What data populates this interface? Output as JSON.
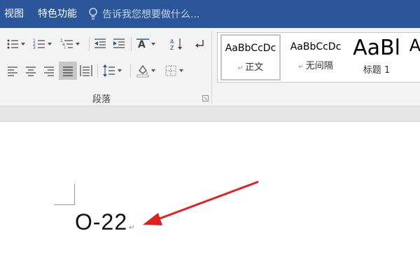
{
  "tabs": {
    "view": "视图",
    "special": "特色功能",
    "tell_me": "告诉我您想要做什么..."
  },
  "ribbon": {
    "paragraph_group_label": "段落",
    "icons": {
      "row1": [
        "bullets-icon",
        "numbering-icon",
        "multilevel-list-icon",
        "decrease-indent-icon",
        "increase-indent-icon",
        "text-direction-icon",
        "sort-icon",
        "paragraph-mark-icon"
      ],
      "row2": [
        "align-left-icon",
        "align-center-icon",
        "align-right-icon",
        "justify-icon",
        "distributed-icon",
        "line-spacing-icon",
        "shading-icon",
        "borders-icon"
      ]
    },
    "active_alignment": "justify"
  },
  "styles": [
    {
      "preview": "AaBbCcDc",
      "name": "正文",
      "selected": true
    },
    {
      "preview": "AaBbCcDc",
      "name": "无间隔",
      "selected": false
    },
    {
      "preview": "AaBl",
      "name": "标题 1",
      "selected": false
    },
    {
      "preview": "A",
      "name": "",
      "selected": false
    }
  ],
  "document": {
    "text": "O-22",
    "paragraph_mark": "↵"
  },
  "colors": {
    "ribbon_blue": "#2b579a",
    "arrow_red": "#e02020"
  }
}
